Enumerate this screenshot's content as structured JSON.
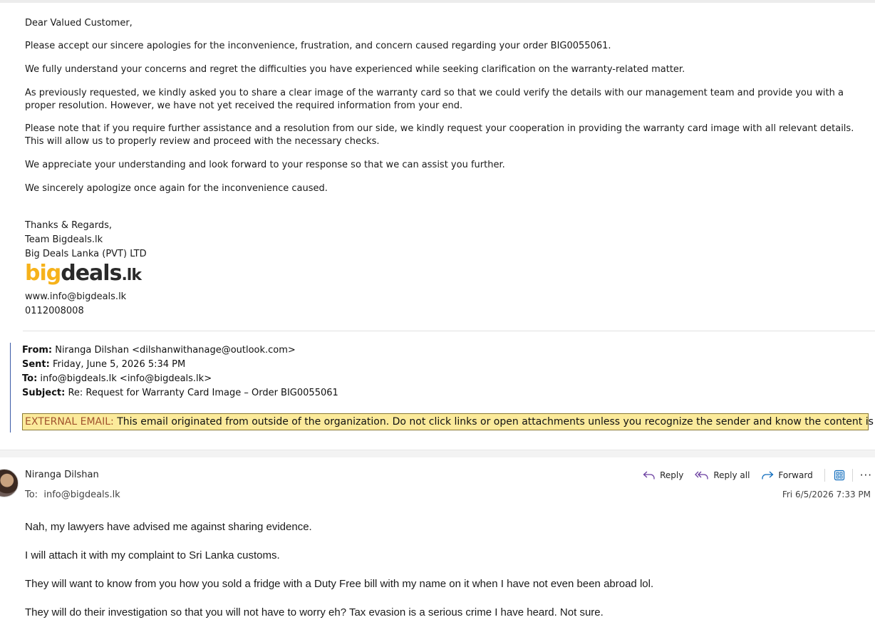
{
  "message": {
    "greeting": "Dear Valued Customer,",
    "paragraphs": [
      "Please accept our sincere apologies for the inconvenience, frustration, and concern caused regarding your order BIG0055061.",
      "We fully understand your concerns and regret the difficulties you have experienced while seeking clarification on the warranty-related matter.",
      "As previously requested, we kindly asked you to share a clear image of the warranty card so that we could verify the details with our management team and provide you with a proper resolution. However, we have not yet received the required information from your end.",
      "Please note that if you require further assistance and a resolution from our side, we kindly request your cooperation in providing the warranty card image with all relevant details. This will allow us to properly review and proceed with the necessary checks.",
      "We appreciate your understanding and look forward to your response so that we can assist you further.",
      "We sincerely apologize once again for the inconvenience caused."
    ],
    "signature": {
      "closing": "Thanks & Regards,",
      "team": "Team Bigdeals.lk",
      "company": "Big Deals Lanka (PVT) LTD",
      "logo_text_big": "big",
      "logo_text_deals": "deals",
      "logo_text_lk": ".lk",
      "website": "www.info@bigdeals.lk",
      "phone": "0112008008"
    }
  },
  "quoted_header": {
    "from_label": "From:",
    "from_value": "Niranga Dilshan <dilshanwithanage@outlook.com>",
    "sent_label": "Sent:",
    "sent_value": "Friday, June 5, 2026 5:34 PM",
    "to_label": "To:",
    "to_value": "info@bigdeals.lk <info@bigdeals.lk>",
    "subject_label": "Subject:",
    "subject_value": "Re: Request for Warranty Card Image – Order BIG0055061"
  },
  "external_banner": {
    "tag": "EXTERNAL EMAIL:",
    "text": "This email originated from outside of the organization. Do not click links or open attachments unless you recognize the sender and know the content is safe."
  },
  "reply_message": {
    "sender_name": "Niranga Dilshan",
    "to_label": "To:",
    "to_value": "info@bigdeals.lk",
    "date": "Fri 6/5/2026 7:33 PM",
    "actions": {
      "reply": "Reply",
      "reply_all": "Reply all",
      "forward": "Forward",
      "more": "···"
    },
    "lines": [
      "Nah, my lawyers have advised me against sharing evidence.",
      "I will attach it with my complaint to Sri Lanka customs.",
      "They will want to know from you how you sold a fridge with a Duty Free bill with my name on it when I have not even been abroad lol.",
      "They will do their investigation so that you will not have to worry eh? Tax evasion is a serious crime I have heard. Not sure."
    ]
  },
  "colors": {
    "accent_blue": "#0f6cbd",
    "banner_bg": "#fbea9b",
    "banner_tag": "#a0522d",
    "logo_yellow": "#f6b21a",
    "quote_bar": "#3b5aa6"
  }
}
